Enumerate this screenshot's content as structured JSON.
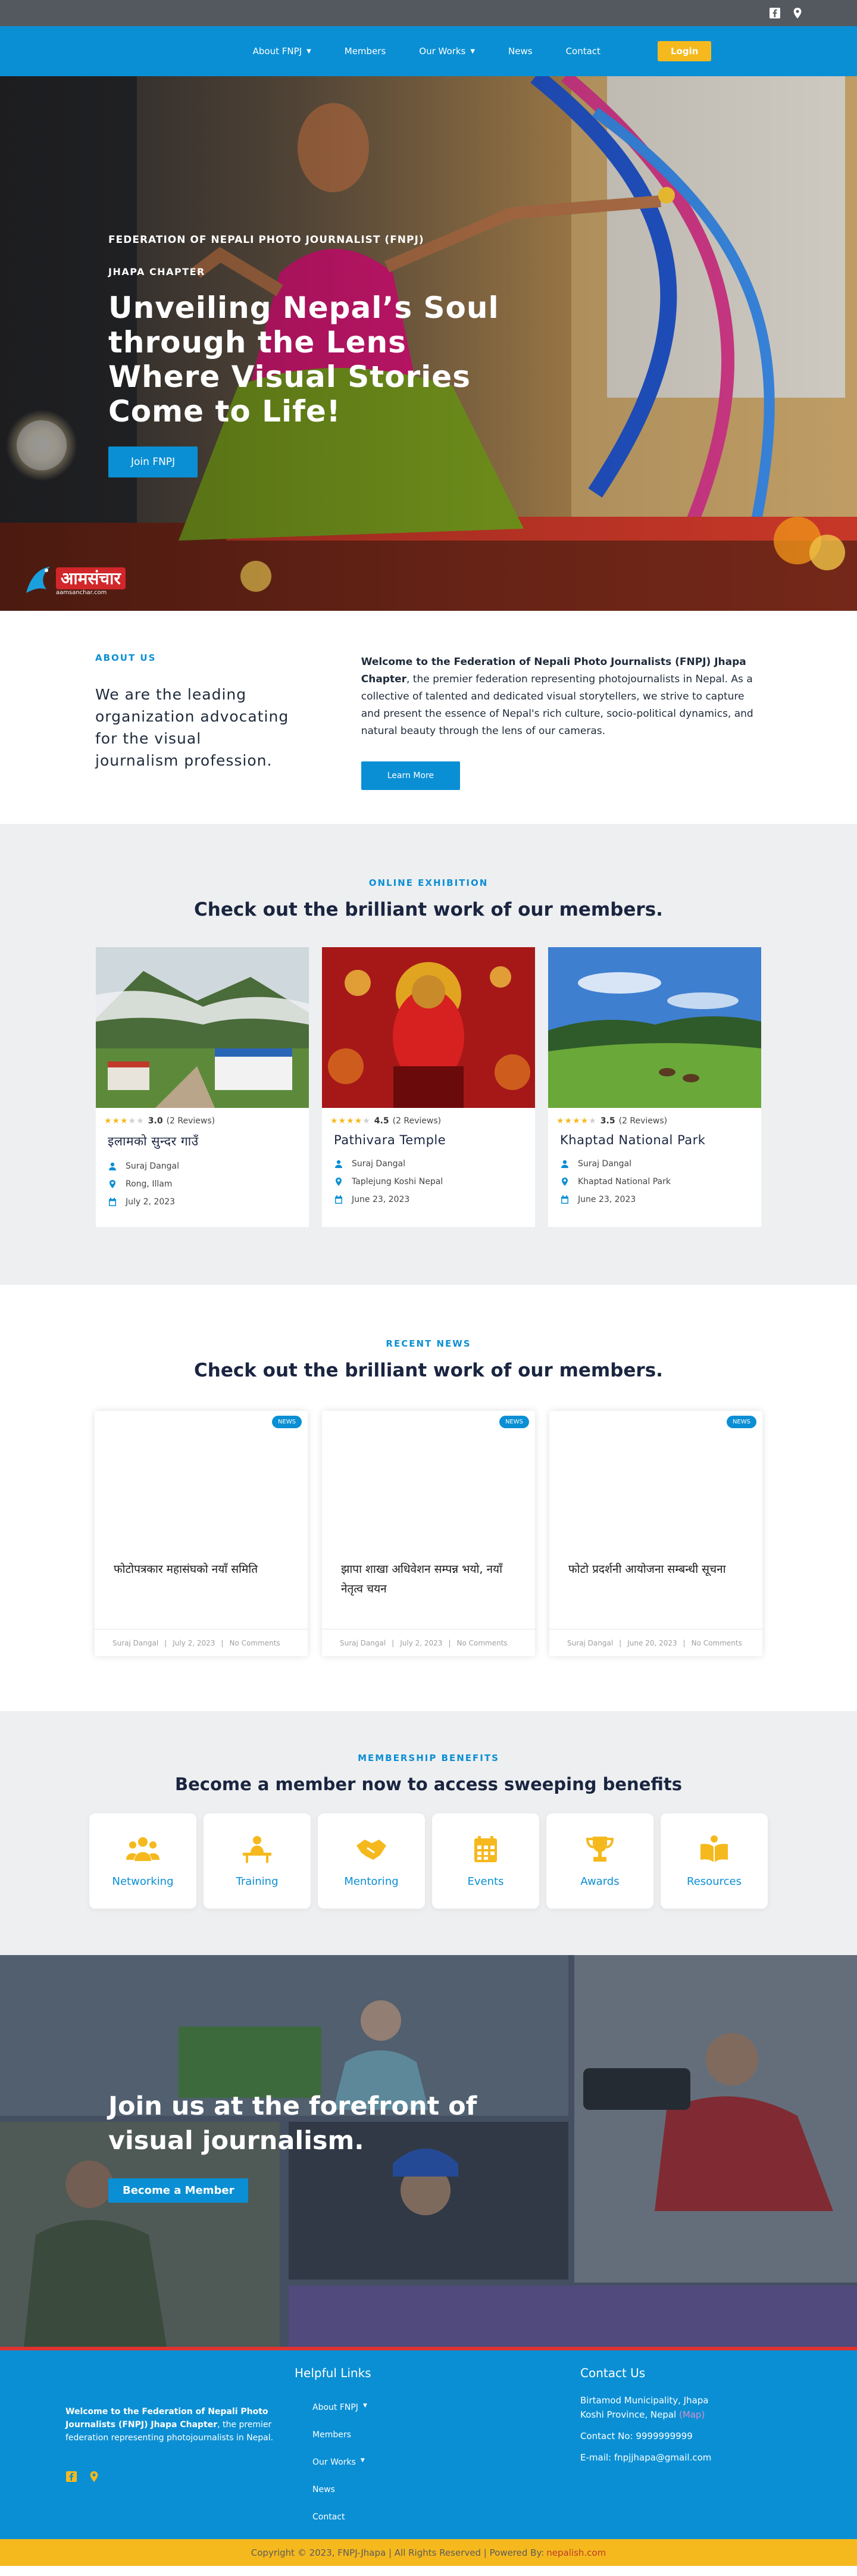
{
  "nav": {
    "items": [
      {
        "label": "About FNPJ",
        "dropdown": true
      },
      {
        "label": "Members",
        "dropdown": false
      },
      {
        "label": "Our Works",
        "dropdown": true
      },
      {
        "label": "News",
        "dropdown": false
      },
      {
        "label": "Contact",
        "dropdown": false
      }
    ],
    "login_label": "Login"
  },
  "hero": {
    "kicker": "FEDERATION OF NEPALI PHOTO JOURNALIST (FNPJ)",
    "sub": "JHAPA CHAPTER",
    "title": "Unveiling Nepal’s Soul through the Lens Where Visual Stories Come to Life!",
    "cta": "Join FNPJ",
    "logo_text": "आमसंचार",
    "logo_url": "aamsanchar.com"
  },
  "about": {
    "eyebrow": "ABOUT US",
    "heading": "We are the leading organization advocating for the visual journalism profession.",
    "body_bold": "Welcome to the Federation of Nepali Photo Journalists (FNPJ) Jhapa Chapter",
    "body_rest": ", the premier federation representing photojournalists in Nepal. As a collective of talented and dedicated visual storytellers, we strive to capture and present the essence of Nepal's rich culture, socio-political dynamics, and natural beauty through the lens of our cameras.",
    "cta": "Learn More"
  },
  "exhibition": {
    "eyebrow": "ONLINE EXHIBITION",
    "title": "Check out the brilliant work of our members.",
    "cards": [
      {
        "rating": "3.0",
        "stars": 3,
        "reviews": "(2 Reviews)",
        "title": "इलामको सुन्दर गाउँ",
        "author": "Suraj Dangal",
        "location": "Rong, Illam",
        "date": "July 2, 2023"
      },
      {
        "rating": "4.5",
        "stars": 4.5,
        "reviews": "(2 Reviews)",
        "title": "Pathivara Temple",
        "author": "Suraj Dangal",
        "location": "Taplejung Koshi Nepal",
        "date": "June 23, 2023"
      },
      {
        "rating": "3.5",
        "stars": 3.5,
        "reviews": "(2 Reviews)",
        "title": "Khaptad National Park",
        "author": "Suraj Dangal",
        "location": "Khaptad National Park",
        "date": "June 23, 2023"
      }
    ]
  },
  "news": {
    "eyebrow": "RECENT NEWS",
    "title": "Check out the brilliant work of our members.",
    "badge": "NEWS",
    "separator": "|",
    "cards": [
      {
        "title": "फोटोपत्रकार महासंघको नयाँ समिति",
        "author": "Suraj Dangal",
        "date": "July 2, 2023",
        "comments": "No Comments"
      },
      {
        "title": "झापा शाखा अधिवेशन सम्पन्न भयो, नयाँ नेतृत्व चयन",
        "author": "Suraj Dangal",
        "date": "July 2, 2023",
        "comments": "No Comments"
      },
      {
        "title": "फोटो प्रदर्शनी आयोजना सम्बन्धी सूचना",
        "author": "Suraj Dangal",
        "date": "June 20, 2023",
        "comments": "No Comments"
      }
    ]
  },
  "membership": {
    "eyebrow": "MEMBERSHIP BENEFITS",
    "title": "Become a member now to access sweeping benefits",
    "benefits": [
      {
        "label": "Networking",
        "icon": "users-icon"
      },
      {
        "label": "Training",
        "icon": "presentation-icon"
      },
      {
        "label": "Mentoring",
        "icon": "handshake-icon"
      },
      {
        "label": "Events",
        "icon": "calendar-icon"
      },
      {
        "label": "Awards",
        "icon": "trophy-icon"
      },
      {
        "label": "Resources",
        "icon": "book-icon"
      }
    ]
  },
  "join": {
    "title": "Join us at the forefront of visual journalism.",
    "cta": "Become a Member"
  },
  "footer": {
    "about_bold": "Welcome to the Federation of Nepali Photo Journalists (FNPJ) Jhapa Chapter",
    "about_rest": ", the premier federation representing photojournalists in Nepal.",
    "links_title": "Helpful Links",
    "links": [
      {
        "label": "About FNPJ",
        "dropdown": true
      },
      {
        "label": "Members",
        "dropdown": false
      },
      {
        "label": "Our Works",
        "dropdown": true
      },
      {
        "label": "News",
        "dropdown": false
      },
      {
        "label": "Contact",
        "dropdown": false
      }
    ],
    "contact_title": "Contact Us",
    "address_line1": "Birtamod Municipality, Jhapa",
    "address_line2": "Koshi Province, Nepal",
    "map_label": "(Map)",
    "phone": "Contact No: 9999999999",
    "email": "E-mail: fnpjjhapa@gmail.com"
  },
  "copyright": {
    "text": "Copyright © 2023, FNPJ-Jhapa |  All Rights Reserved | Powered By:",
    "powered": "nepalish.com"
  },
  "colors": {
    "primary": "#0a8fd4",
    "accent": "#f5b91e",
    "topbar": "#54595f",
    "section_bg": "#eeeff1",
    "footer_line": "#e0322f"
  }
}
